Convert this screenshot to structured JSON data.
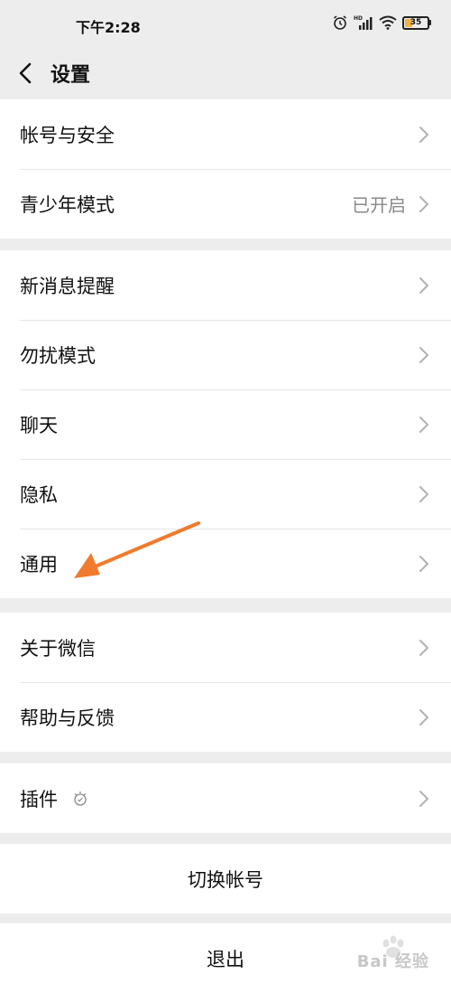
{
  "status_bar": {
    "time": "下午2:28",
    "battery_level": 35,
    "battery_label": "35",
    "battery_color": "#f0b43a",
    "icons": [
      "alarm-icon",
      "hd-signal-icon",
      "wifi-icon",
      "battery-icon"
    ]
  },
  "header": {
    "title": "设置",
    "back_icon": "chevron-left-icon"
  },
  "groups": [
    {
      "items": [
        {
          "label": "帐号与安全"
        },
        {
          "label": "青少年模式",
          "value": "已开启"
        }
      ]
    },
    {
      "items": [
        {
          "label": "新消息提醒"
        },
        {
          "label": "勿扰模式"
        },
        {
          "label": "聊天"
        },
        {
          "label": "隐私"
        },
        {
          "label": "通用"
        }
      ]
    },
    {
      "items": [
        {
          "label": "关于微信"
        },
        {
          "label": "帮助与反馈"
        }
      ]
    },
    {
      "items": [
        {
          "label": "插件",
          "icon": "plugin-bulb-icon"
        }
      ]
    }
  ],
  "actions": {
    "switch_account": "切换帐号",
    "logout": "退出"
  },
  "annotation": {
    "arrow_color": "#f07a2d",
    "arrow_target": "通用"
  },
  "watermark": {
    "text": "Bai 经验",
    "icon": "baidu-paw-logo"
  }
}
